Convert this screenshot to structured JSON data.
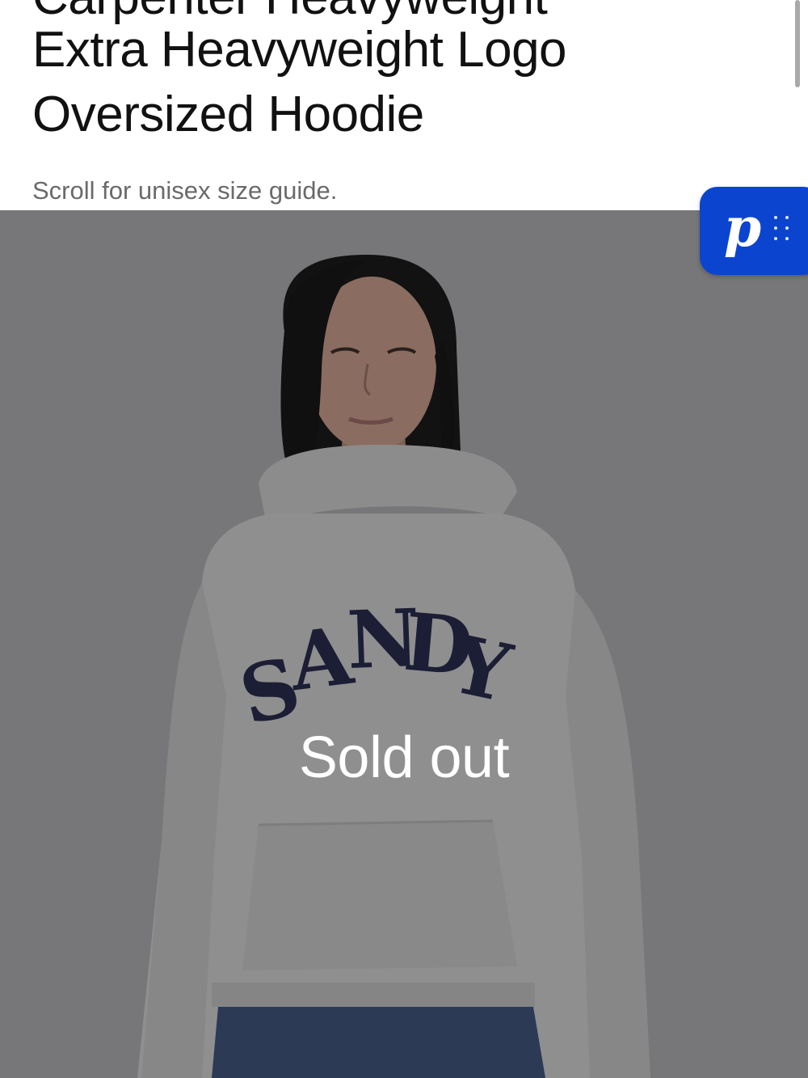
{
  "product": {
    "title_clipped": "Carpenter Heavyweight",
    "title_line1": "Extra Heavyweight Logo",
    "title_line2": "Oversized Hoodie",
    "size_guide_hint": "Scroll for unisex size guide."
  },
  "image": {
    "alt": "",
    "status_overlay": "Sold out",
    "hoodie_graphic_text": "SANDY",
    "colors": {
      "background": "#777779",
      "hoodie": "#8f8f90",
      "hair": "#121212",
      "skin": "#8a6d60",
      "lettering": "#1b1e34",
      "denim": "#2c3a55"
    }
  },
  "widget": {
    "letter": "p",
    "icon": "drag-handle-icon",
    "color": "#0b44cf"
  }
}
